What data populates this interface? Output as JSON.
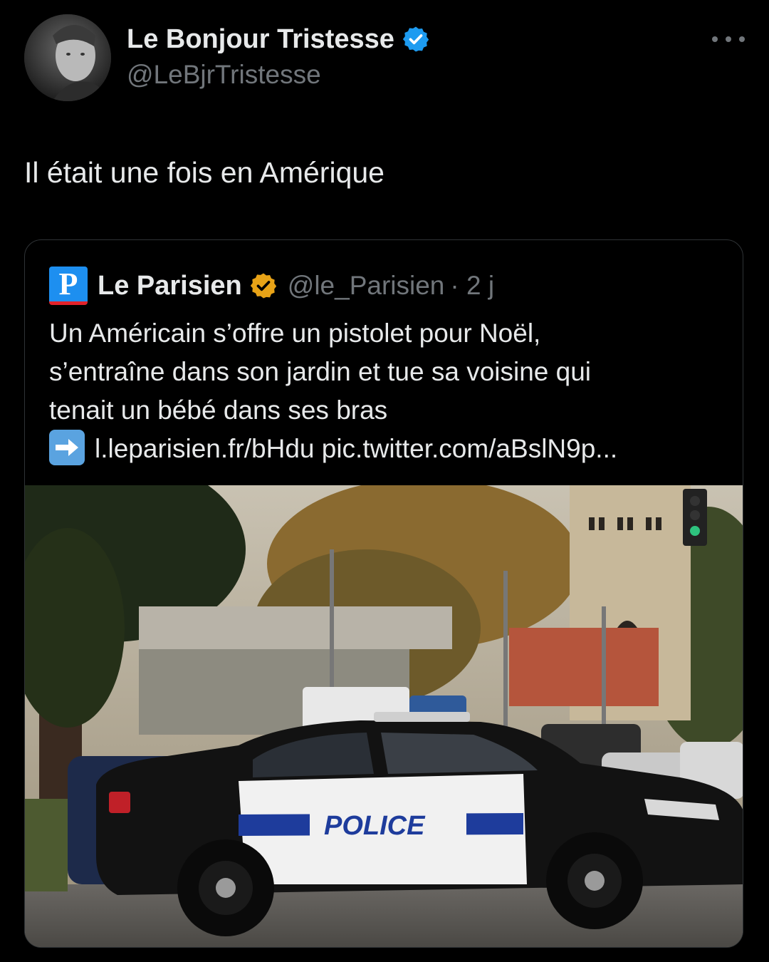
{
  "author": {
    "display_name": "Le Bonjour Tristesse",
    "handle": "@LeBjrTristesse",
    "verified": true,
    "badge_color": "#1d9bf0"
  },
  "tweet": {
    "text": "Il était une fois en Amérique"
  },
  "quoted": {
    "name": "Le Parisien",
    "logo_letter": "P",
    "badge_color": "#e8a317",
    "handle": "@le_Parisien",
    "time": "· 2 j",
    "text_lines": [
      "Un Américain s’offre un pistolet pour Noël,",
      "s’entraîne dans son jardin et tue sa voisine qui",
      "tenait un bébé dans ses bras"
    ],
    "link_line": "l.leparisien.fr/bHdu pic.twitter.com/aBslN9p...",
    "arrow_icon": "right-arrow-emoji-icon",
    "image": {
      "description_icon": "police-car-photo",
      "car_text": "POLICE"
    }
  },
  "icons": {
    "more": "more-options-icon",
    "verified": "verified-badge-icon"
  }
}
